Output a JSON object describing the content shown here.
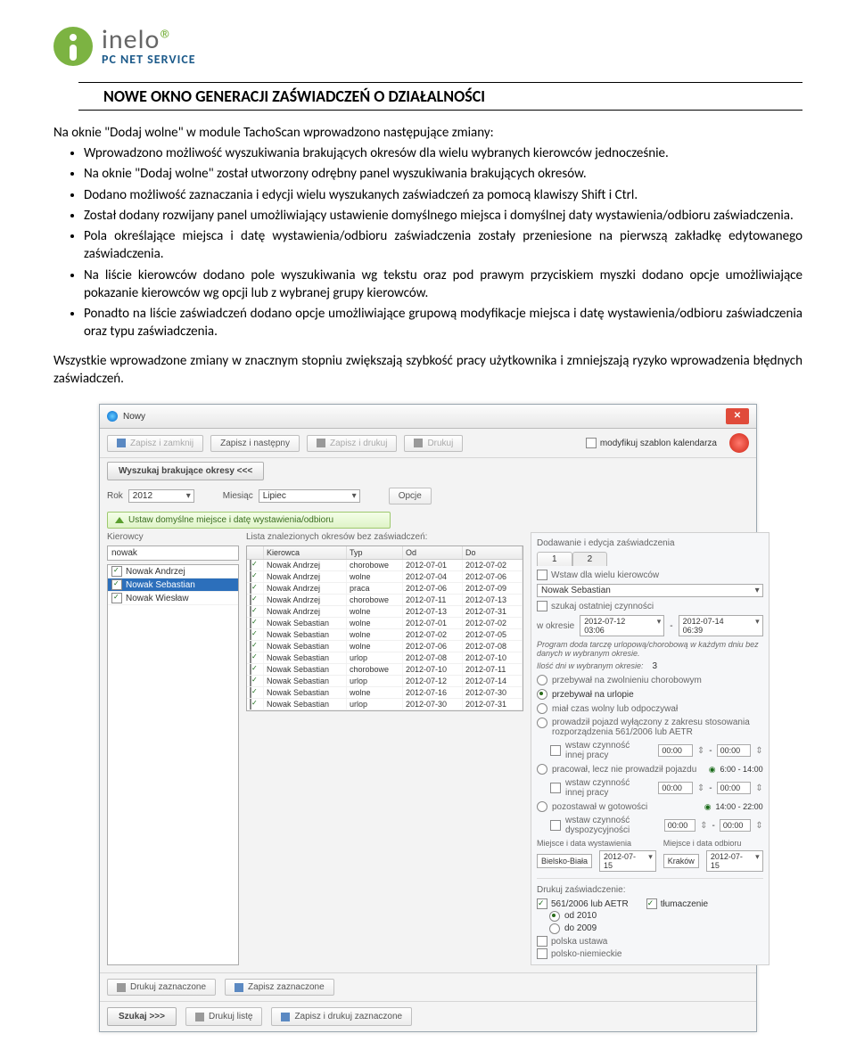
{
  "logo": {
    "brand": "inelo",
    "sub": "PC NET SERVICE"
  },
  "title": "NOWE OKNO GENERACJI ZAŚWIADCZEŃ O DZIAŁALNOŚCI",
  "intro": "Na oknie \"Dodaj wolne\" w module TachoScan wprowadzono następujące zmiany:",
  "bullets": [
    "Wprowadzono możliwość wyszukiwania brakujących okresów dla wielu wybranych kierowców jednocześnie.",
    "Na oknie \"Dodaj wolne\" został utworzony odrębny panel wyszukiwania brakujących okresów.",
    "Dodano możliwość zaznaczania i edycji wielu wyszukanych zaświadczeń za pomocą klawiszy Shift i Ctrl.",
    "Został dodany rozwijany panel umożliwiający ustawienie domyślnego miejsca i domyślnej daty wystawienia/odbioru zaświadczenia.",
    "Pola określające miejsca i datę wystawienia/odbioru zaświadczenia zostały przeniesione na pierwszą zakładkę edytowanego zaświadczenia.",
    "Na liście kierowców dodano pole wyszukiwania wg tekstu oraz pod prawym przyciskiem myszki dodano opcje umożliwiające pokazanie kierowców wg opcji lub z wybranej grupy kierowców.",
    "Ponadto na liście zaświadczeń dodano opcje umożliwiające grupową modyfikacje miejsca i datę wystawienia/odbioru zaświadczenia oraz typu zaświadczenia."
  ],
  "closing": "Wszystkie wprowadzone zmiany w znacznym stopniu zwiększają szybkość pracy użytkownika i zmniejszają ryzyko wprowadzenia błędnych zaświadczeń.",
  "dlg": {
    "title": "Nowy",
    "toolbar": {
      "save_close": "Zapisz i zamknij",
      "save_next": "Zapisz i następny",
      "save_print": "Zapisz i drukuj",
      "print": "Drukuj",
      "modify_tpl": "modyfikuj szablon kalendarza"
    },
    "search_btn": "Wyszukaj brakujące okresy <<<",
    "year_label": "Rok",
    "year": "2012",
    "month_label": "Miesiąc",
    "month": "Lipiec",
    "opts": "Opcje",
    "defaults_btn": "Ustaw domyślne miejsce i datę wystawienia/odbioru",
    "drivers_label": "Kierowcy",
    "periods_label": "Lista znalezionych okresów bez zaświadczeń:",
    "driver_search": "nowak",
    "drivers": [
      {
        "name": "Nowak Andrzej",
        "on": true,
        "sel": false
      },
      {
        "name": "Nowak Sebastian",
        "on": true,
        "sel": true
      },
      {
        "name": "Nowak Wiesław",
        "on": true,
        "sel": false
      }
    ],
    "cols": {
      "driver": "Kierowca",
      "type": "Typ",
      "from": "Od",
      "to": "Do"
    },
    "rows": [
      {
        "d": "Nowak Andrzej",
        "t": "chorobowe",
        "od": "2012-07-01",
        "do": "2012-07-02"
      },
      {
        "d": "Nowak Andrzej",
        "t": "wolne",
        "od": "2012-07-04",
        "do": "2012-07-06"
      },
      {
        "d": "Nowak Andrzej",
        "t": "praca",
        "od": "2012-07-06",
        "do": "2012-07-09"
      },
      {
        "d": "Nowak Andrzej",
        "t": "chorobowe",
        "od": "2012-07-11",
        "do": "2012-07-13"
      },
      {
        "d": "Nowak Andrzej",
        "t": "wolne",
        "od": "2012-07-13",
        "do": "2012-07-31"
      },
      {
        "d": "Nowak Sebastian",
        "t": "wolne",
        "od": "2012-07-01",
        "do": "2012-07-02"
      },
      {
        "d": "Nowak Sebastian",
        "t": "wolne",
        "od": "2012-07-02",
        "do": "2012-07-05"
      },
      {
        "d": "Nowak Sebastian",
        "t": "wolne",
        "od": "2012-07-06",
        "do": "2012-07-08"
      },
      {
        "d": "Nowak Sebastian",
        "t": "urlop",
        "od": "2012-07-08",
        "do": "2012-07-10"
      },
      {
        "d": "Nowak Sebastian",
        "t": "chorobowe",
        "od": "2012-07-10",
        "do": "2012-07-11"
      },
      {
        "d": "Nowak Sebastian",
        "t": "urlop",
        "od": "2012-07-12",
        "do": "2012-07-14"
      },
      {
        "d": "Nowak Sebastian",
        "t": "wolne",
        "od": "2012-07-16",
        "do": "2012-07-30"
      },
      {
        "d": "Nowak Sebastian",
        "t": "urlop",
        "od": "2012-07-30",
        "do": "2012-07-31"
      }
    ],
    "edit": {
      "header": "Dodawanie i edycja zaświadczenia",
      "tab1": "1",
      "tab2": "2",
      "many": "Wstaw dla wielu kierowców",
      "driver": "Nowak Sebastian",
      "last_act": "szukaj ostatniej czynności",
      "period_lbl": "w okresie",
      "period_from": "2012-07-12 03:06",
      "period_to": "2012-07-14 06:39",
      "note": "Program doda tarczę urlopową/chorobową w każdym dniu bez danych w wybranym okresie.",
      "days_lbl": "Ilość dni w wybranym okresie:",
      "days": "3",
      "opt_sick": "przebywał na zwolnieniu chorobowym",
      "opt_vac": "przebywał na urlopie",
      "opt_free": "miał czas wolny lub odpoczywał",
      "opt_561": "prowadził pojazd wyłączony z zakresu stosowania rozporządzenia 561/2006 lub AETR",
      "ins1": "wstaw czynność innej pracy",
      "t1a": "00:00",
      "t1b": "00:00",
      "opt_work": "pracował, lecz nie prowadził pojazdu",
      "ins2": "wstaw czynność innej pracy",
      "t2a": "00:00",
      "t2b": "00:00",
      "opt_standby": "pozostawał w gotowości",
      "time_work": "6:00 - 14:00",
      "time_standby": "14:00 - 22:00",
      "ins3": "wstaw czynność dyspozycyjności",
      "t3a": "00:00",
      "t3b": "00:00",
      "place_iss": "Miejsce i data wystawienia",
      "place_rcv": "Miejsce i data odbioru",
      "city1": "Bielsko-Biała",
      "date1": "2012-07-15",
      "city2": "Kraków",
      "date2": "2012-07-15",
      "print_lbl": "Drukuj zaświadczenie:",
      "r561": "561/2006 lub AETR",
      "r2010": "od 2010",
      "r2009": "do 2009",
      "rpl": "polska ustawa",
      "rplm": "polsko-niemieckie",
      "rtlum": "tłumaczenie"
    },
    "footer": {
      "print_sel": "Drukuj zaznaczone",
      "save_sel": "Zapisz zaznaczone",
      "search": "Szukaj >>>",
      "print_list": "Drukuj listę",
      "save_print_sel": "Zapisz i drukuj zaznaczone"
    }
  }
}
